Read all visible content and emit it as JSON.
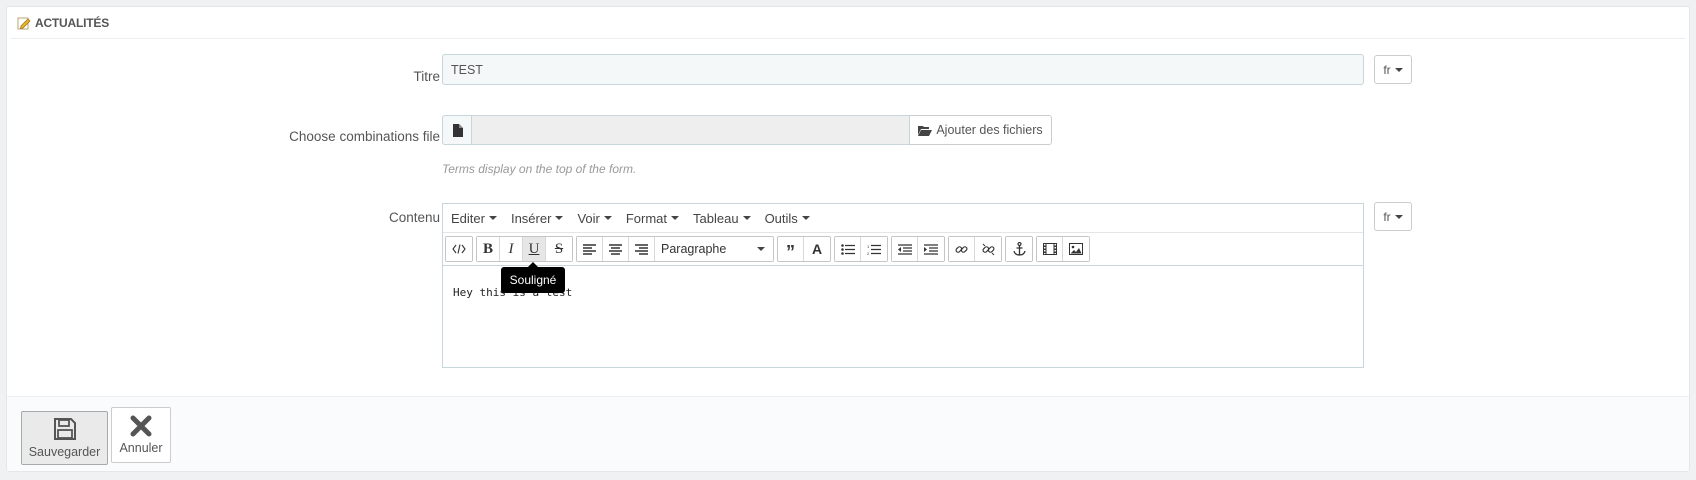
{
  "panel": {
    "title": "ACTUALITÉS",
    "heading_icon": "pencil-icon"
  },
  "form": {
    "title_field": {
      "label": "Titre",
      "value": "TEST",
      "lang": "fr"
    },
    "file_field": {
      "label": "Choose combinations file",
      "button_label": "Ajouter des fichiers",
      "help_text": "Terms display on the top of the form."
    },
    "content_field": {
      "label": "Contenu",
      "lang": "fr"
    }
  },
  "editor": {
    "menu": [
      "Editer",
      "Insérer",
      "Voir",
      "Format",
      "Tableau",
      "Outils"
    ],
    "format_select": "Paragraphe",
    "content": "Hey this is a test",
    "tooltip": "Souligné",
    "toolbar_icons": [
      "code-icon",
      "bold-icon",
      "italic-icon",
      "underline-icon",
      "strikethrough-icon",
      "align-left-icon",
      "align-center-icon",
      "align-right-icon",
      "blockquote-icon",
      "text-color-icon",
      "bullet-list-icon",
      "numbered-list-icon",
      "outdent-icon",
      "indent-icon",
      "link-icon",
      "unlink-icon",
      "anchor-icon",
      "media-icon",
      "image-icon"
    ]
  },
  "footer": {
    "save_label": "Sauvegarder",
    "cancel_label": "Annuler"
  },
  "colors": {
    "input_bg": "#f5f8f9",
    "input_border": "#c7d6db",
    "tooltip_bg": "#000000"
  }
}
